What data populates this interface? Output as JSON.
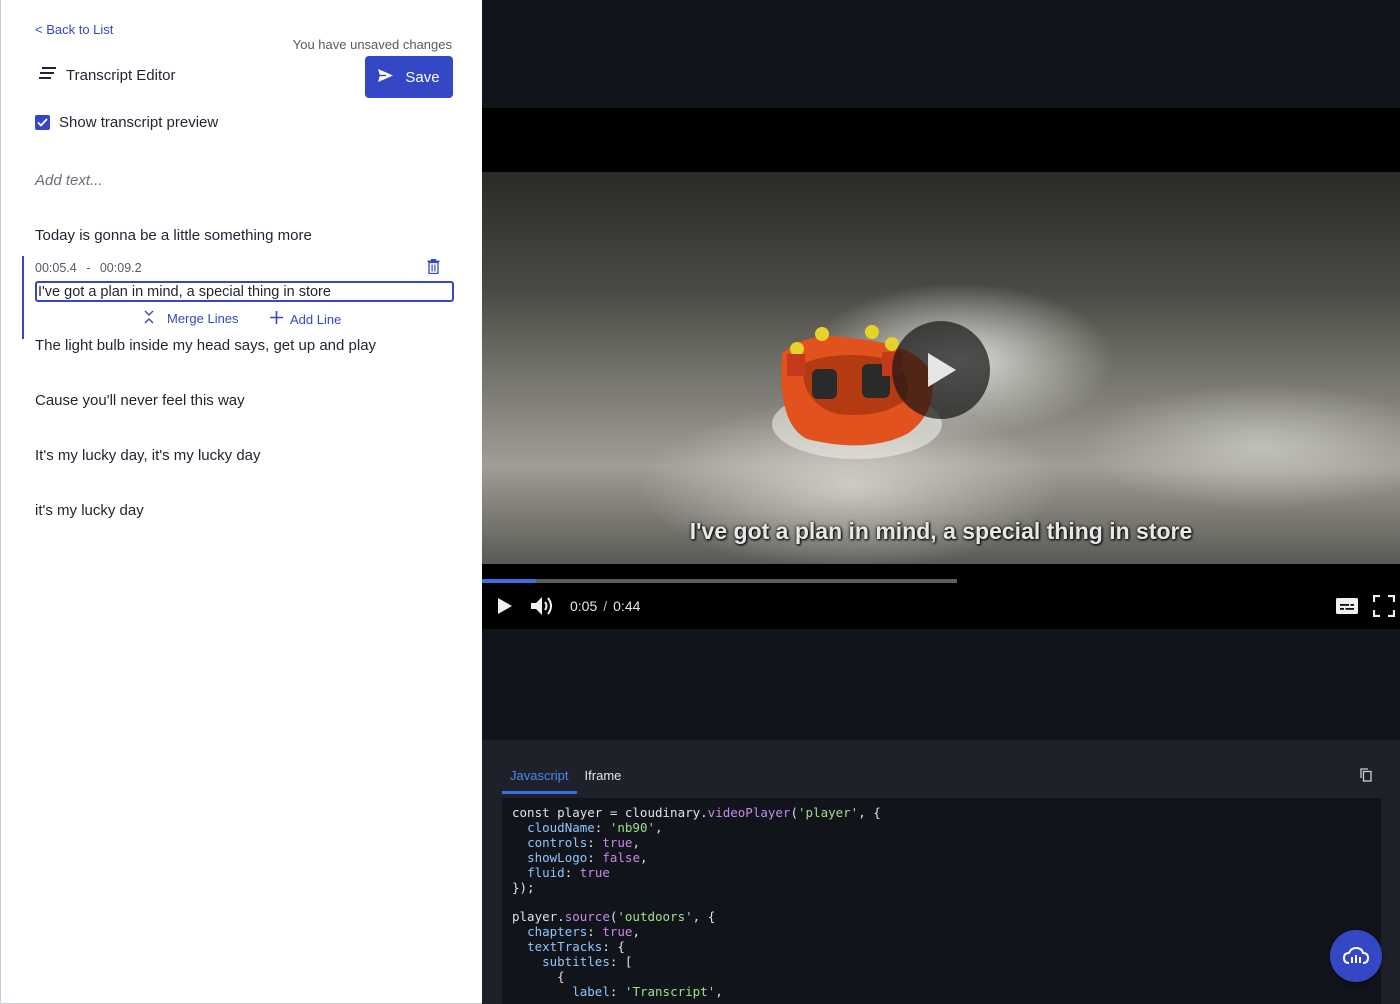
{
  "editor": {
    "back_link": "< Back to List",
    "unsaved_notice": "You have unsaved changes",
    "title": "Transcript Editor",
    "save_label": "Save",
    "show_preview_label": "Show transcript preview",
    "show_preview_checked": true,
    "add_text_placeholder": "Add text...",
    "lines": [
      "Today is gonna be a little something more",
      "I've got a plan in mind, a special thing in store",
      "The light bulb inside my head says, get up and play",
      "Cause you'll never feel this way",
      "It's my lucky day, it's my lucky day",
      "it's my lucky day"
    ],
    "active_line": {
      "start": "00:05.4",
      "separator": "-",
      "end": "00:09.2",
      "value": "I've got a plan in mind, a special thing in store",
      "merge_label": "Merge Lines",
      "add_label": "Add Line"
    }
  },
  "player": {
    "subtitle": "I've got a plan in mind, a special thing in store",
    "current_time": "0:05",
    "time_separator": "/",
    "duration": "0:44",
    "progress_fraction": 0.114
  },
  "code": {
    "tabs": [
      "Javascript",
      "Iframe"
    ],
    "active_tab": "Javascript",
    "snippet_lines": [
      "const player = cloudinary.videoPlayer('player', {",
      "  cloudName: 'nb90',",
      "  controls: true,",
      "  showLogo: false,",
      "  fluid: true",
      "});",
      "",
      "player.source('outdoors', {",
      "  chapters: true,",
      "  textTracks: {",
      "    subtitles: [",
      "      {",
      "        label: 'Transcript',"
    ]
  },
  "colors": {
    "accent": "#3448c5",
    "progress": "#3a6fe0",
    "code_bg": "#11141a"
  },
  "icons": [
    "lines-icon",
    "send-icon",
    "checkmark-icon",
    "trash-icon",
    "merge-icon",
    "plus-icon",
    "play-icon",
    "volume-icon",
    "captions-icon",
    "fullscreen-icon",
    "copy-icon",
    "cloud-icon"
  ]
}
